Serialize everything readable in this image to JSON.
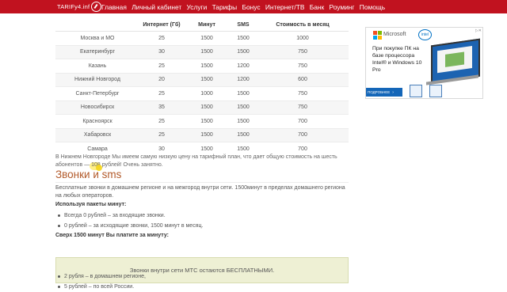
{
  "site": {
    "logo_text": "TARIFy4.inf"
  },
  "nav": [
    {
      "label": "Главная"
    },
    {
      "label": "Личный кабинет"
    },
    {
      "label": "Услуги"
    },
    {
      "label": "Тарифы"
    },
    {
      "label": "Бонус"
    },
    {
      "label": "Интернет/ТВ"
    },
    {
      "label": "Банк"
    },
    {
      "label": "Роуминг"
    },
    {
      "label": "Помощь"
    }
  ],
  "table": {
    "headers": [
      "",
      "Интернет (Гб)",
      "Минут",
      "SMS",
      "Стоимость в месяц"
    ],
    "rows": [
      [
        "Москва и МО",
        "25",
        "1500",
        "1500",
        "1000"
      ],
      [
        "Екатеринбург",
        "30",
        "1500",
        "1500",
        "750"
      ],
      [
        "Казань",
        "25",
        "1500",
        "1200",
        "750"
      ],
      [
        "Нижний Новгород",
        "20",
        "1500",
        "1200",
        "600"
      ],
      [
        "Санкт-Петербург",
        "25",
        "1000",
        "1500",
        "750"
      ],
      [
        "Новосибирск",
        "35",
        "1500",
        "1500",
        "750"
      ],
      [
        "Красноярск",
        "25",
        "1500",
        "1500",
        "700"
      ],
      [
        "Хабаровск",
        "25",
        "1500",
        "1500",
        "700"
      ],
      [
        "Самара",
        "30",
        "1500",
        "1500",
        "700"
      ]
    ]
  },
  "note": {
    "part1": "В Нижнем Новгороде Мы имеем самую низкую цену на тарифный план, что дает общую стоимость на шесть абонентов — ",
    "highlight": "108",
    "part2": " рублей! Очень занятно."
  },
  "section": {
    "title": "Звонки и sms",
    "paragraph": "Бесплатные звонки в домашнем регионе и на межгород внутри сети. 1500минут в пределах домашнего региона на любых операторов.",
    "packages_heading": "Используя пакеты минут:",
    "packages": [
      "Всегда 0 рублей – за входящие звонки.",
      "0 рублей – за исходящие звонки,  1500 минут в месяц."
    ],
    "over_heading": "Сверх 1500 минут Вы платите за минуту:",
    "green_box": "Звонки внутри сети МТС остаются БЕСПЛАТНЫМИ.",
    "over_items": [
      "2 рубля – в домашнем регионе,",
      "5 рублей – по всей России."
    ]
  },
  "ad": {
    "brand": "Microsoft",
    "intel": "intel",
    "text": "При покупке ПК на базе процессора Intel® и Windows 10 Pro",
    "button": "ПОДРОБНЕЕ",
    "button_arrow": "›",
    "close": "▷✕",
    "ms_colors": [
      "#f25022",
      "#7fba00",
      "#00a4ef",
      "#ffb900"
    ]
  }
}
